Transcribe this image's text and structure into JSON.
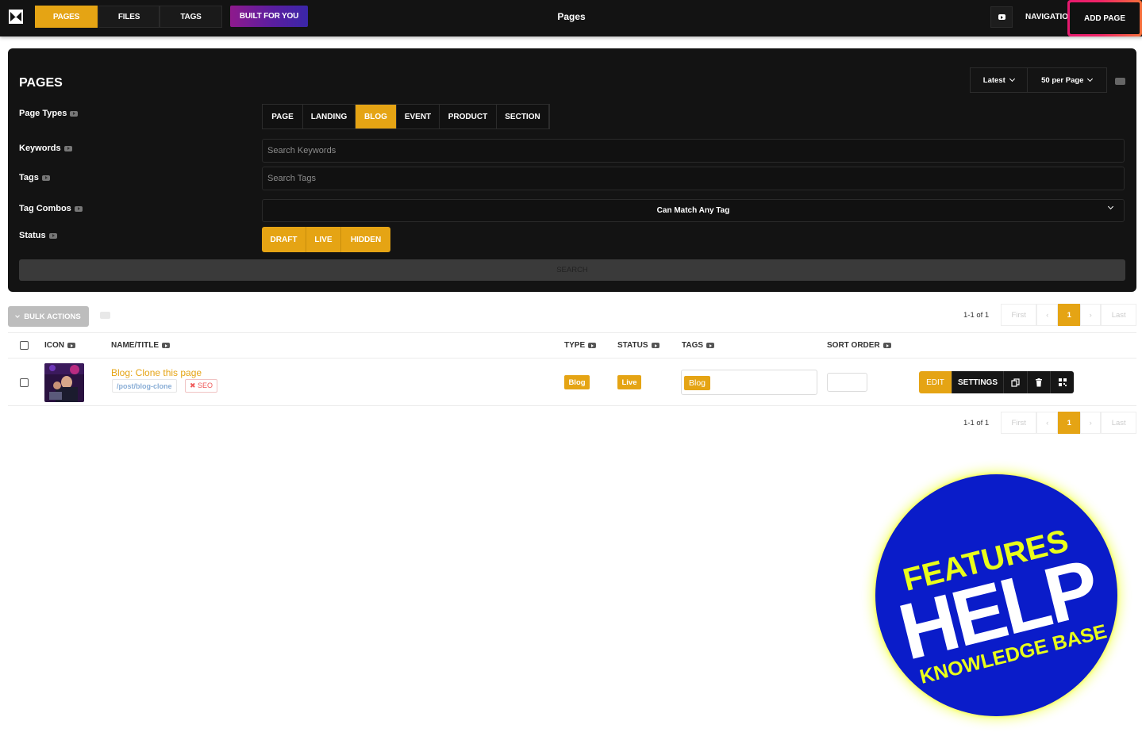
{
  "topbar": {
    "tabs": [
      "PAGES",
      "FILES",
      "TAGS"
    ],
    "built_for_you": "BUILT FOR YOU",
    "title": "Pages",
    "navigation": "NAVIGATION",
    "add_page": "ADD PAGE"
  },
  "panel": {
    "title": "PAGES",
    "sort": "Latest",
    "per_page": "50 per Page",
    "labels": {
      "page_types": "Page Types",
      "keywords": "Keywords",
      "tags": "Tags",
      "tag_combos": "Tag Combos",
      "status": "Status"
    },
    "page_types": [
      "PAGE",
      "LANDING",
      "BLOG",
      "EVENT",
      "PRODUCT",
      "SECTION"
    ],
    "active_type": "BLOG",
    "keywords_placeholder": "Search Keywords",
    "tags_placeholder": "Search Tags",
    "tag_combo": "Can Match Any Tag",
    "statuses": [
      "DRAFT",
      "LIVE",
      "HIDDEN"
    ],
    "search_button": "SEARCH"
  },
  "list": {
    "bulk_actions": "BULK ACTIONS",
    "count": "1-1 of 1",
    "pager": [
      "First",
      "‹",
      "1",
      "›",
      "Last"
    ],
    "current_page": "1",
    "columns": {
      "icon": "ICON",
      "name": "NAME/TITLE",
      "type": "TYPE",
      "status": "STATUS",
      "tags": "TAGS",
      "sort_order": "SORT ORDER"
    },
    "rows": [
      {
        "title": "Blog: Clone this page",
        "slug": "/post/blog-clone",
        "seo": "✖ SEO",
        "type": "Blog",
        "status": "Live",
        "tag": "Blog",
        "sort_order": ""
      }
    ],
    "actions": {
      "edit": "EDIT",
      "settings": "SETTINGS"
    }
  },
  "badge": {
    "line1": "FEATURES",
    "line2": "HELP",
    "line3": "KNOWLEDGE BASE"
  },
  "colors": {
    "accent": "#e5a414",
    "dark": "#131313",
    "badge_blue": "#0a1cc9",
    "badge_yellow": "#e9ff1a"
  }
}
